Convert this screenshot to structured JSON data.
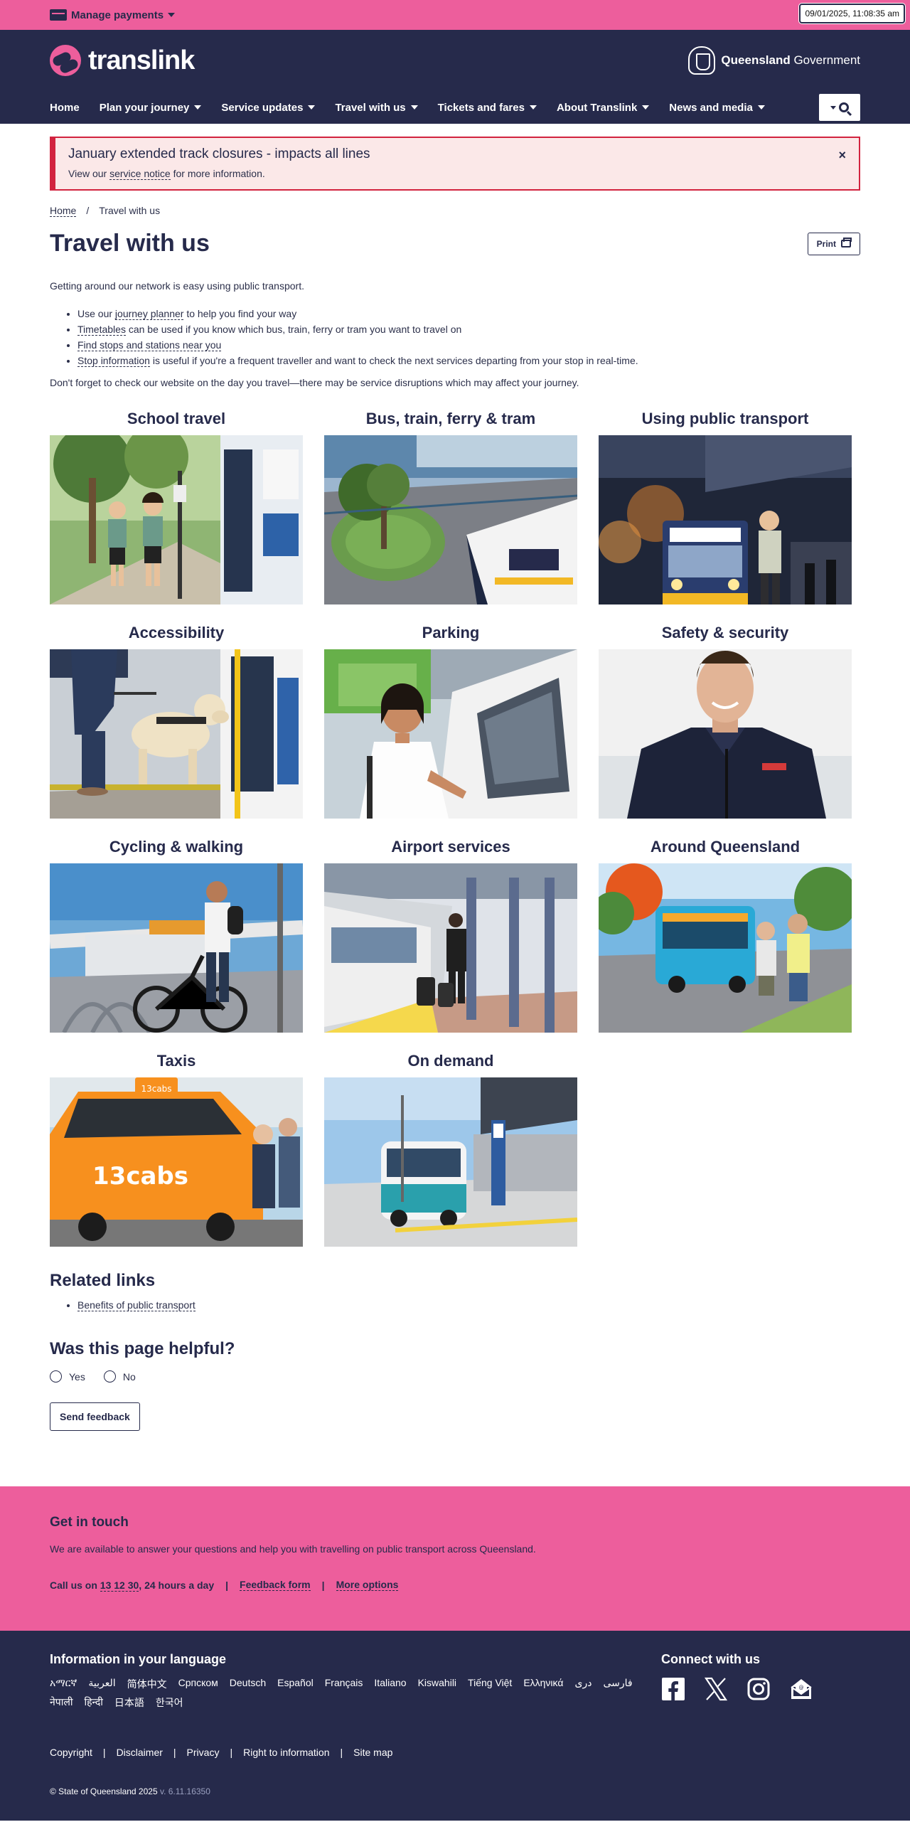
{
  "utility": {
    "manage_payments": "Manage payments",
    "datetime": "09/01/2025, 11:08:35 am"
  },
  "brand": {
    "name": "translink"
  },
  "government": {
    "bold": "Queensland",
    "rest": " Government"
  },
  "nav": {
    "items": [
      {
        "label": "Home",
        "dropdown": false
      },
      {
        "label": "Plan your journey",
        "dropdown": true
      },
      {
        "label": "Service updates",
        "dropdown": true
      },
      {
        "label": "Travel with us",
        "dropdown": true
      },
      {
        "label": "Tickets and fares",
        "dropdown": true
      },
      {
        "label": "About Translink",
        "dropdown": true
      },
      {
        "label": "News and media",
        "dropdown": true
      }
    ]
  },
  "alert": {
    "title": "January extended track closures - impacts all lines",
    "text_before": "View our ",
    "link": "service notice",
    "text_after": " for more information.",
    "close": "×"
  },
  "breadcrumb": {
    "home": "Home",
    "separator": "/",
    "current": "Travel with us"
  },
  "page": {
    "title": "Travel with us",
    "print": "Print",
    "intro": "Getting around our network is easy using public transport.",
    "list": [
      {
        "before": "Use our ",
        "link": "journey planner",
        "after": " to help you find your way"
      },
      {
        "before": "",
        "link": "Timetables",
        "after": " can be used if you know which bus, train, ferry or tram you want to travel on"
      },
      {
        "before": "",
        "link": "Find stops and stations near you",
        "after": ""
      },
      {
        "before": "",
        "link": "Stop information",
        "after": " is useful if you're a frequent traveller and want to check the next services departing from your stop in real-time."
      }
    ],
    "outro": "Don't forget to check our website on the day you travel—there may be service disruptions which may affect your journey."
  },
  "cards": [
    {
      "title": "School travel",
      "scene": "school"
    },
    {
      "title": "Bus, train, ferry & tram",
      "scene": "bus"
    },
    {
      "title": "Using public transport",
      "scene": "night"
    },
    {
      "title": "Accessibility",
      "scene": "dog"
    },
    {
      "title": "Parking",
      "scene": "parking"
    },
    {
      "title": "Safety & security",
      "scene": "guard"
    },
    {
      "title": "Cycling & walking",
      "scene": "cycle"
    },
    {
      "title": "Airport services",
      "scene": "airport"
    },
    {
      "title": "Around Queensland",
      "scene": "around"
    },
    {
      "title": "Taxis",
      "scene": "taxi"
    },
    {
      "title": "On demand",
      "scene": "ondemand"
    }
  ],
  "related": {
    "title": "Related links",
    "links": [
      "Benefits of public transport"
    ]
  },
  "helpful": {
    "title": "Was this page helpful?",
    "yes": "Yes",
    "no": "No",
    "button": "Send feedback"
  },
  "touch": {
    "title": "Get in touch",
    "text": "We are available to answer your questions and help you with travelling on public transport across Queensland.",
    "call_before": "Call us on ",
    "phone": "13 12 30",
    "call_after": ", 24 hours a day",
    "sep": "|",
    "feedback": "Feedback form",
    "more": "More options"
  },
  "footer": {
    "lang_title": "Information in your language",
    "languages": [
      "አማርኛ",
      "العربية",
      "简体中文",
      "Српском",
      "Deutsch",
      "Español",
      "Français",
      "Italiano",
      "Kiswahili",
      "Tiếng Việt",
      "Ελληνικά",
      "دری",
      "فارسی",
      "नेपाली",
      "हिन्दी",
      "日本語",
      "한국어"
    ],
    "connect_title": "Connect with us",
    "social": [
      "facebook-icon",
      "x-icon",
      "instagram-icon",
      "email-icon"
    ],
    "links": [
      "Copyright",
      "Disclaimer",
      "Privacy",
      "Right to information",
      "Site map"
    ],
    "sep": "|",
    "copyright": "© State of Queensland 2025",
    "version": " v. 6.11.16350"
  },
  "colors": {
    "pink": "#ed5e9c",
    "navy": "#262a4b",
    "alert_red": "#d2233f",
    "alert_bg": "#fbe8e8"
  }
}
